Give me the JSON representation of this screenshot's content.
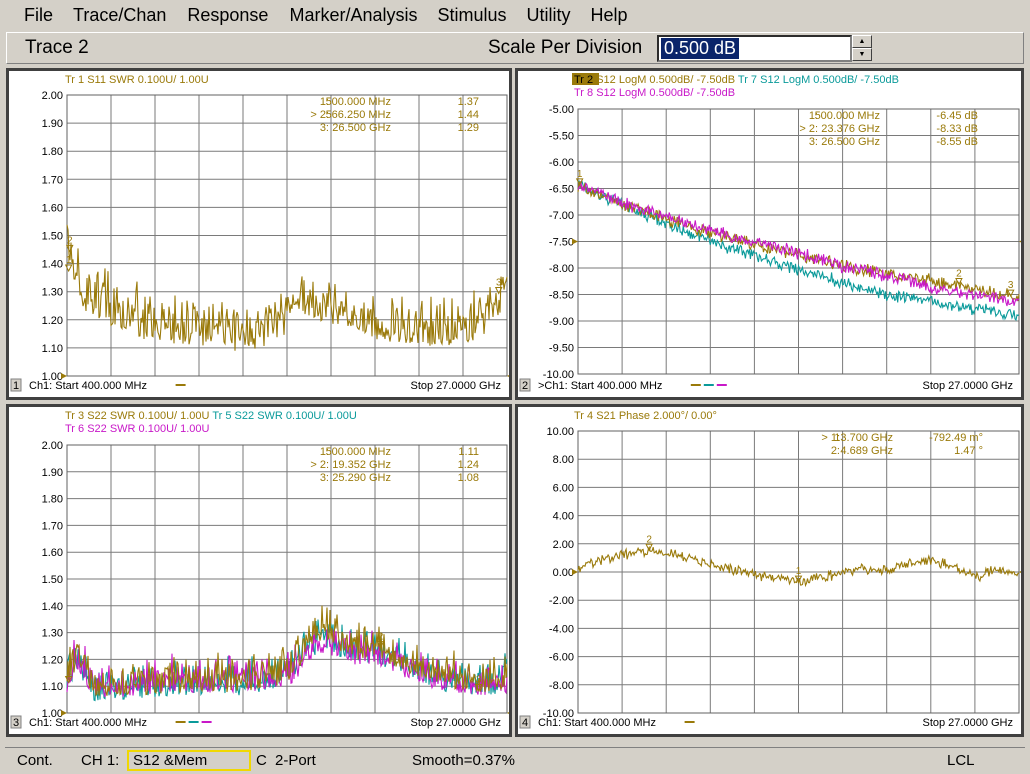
{
  "menu": [
    "File",
    "Trace/Chan",
    "Response",
    "Marker/Analysis",
    "Stimulus",
    "Utility",
    "Help"
  ],
  "toolbar": {
    "trace_name": "Trace 2",
    "spd_label": "Scale Per Division",
    "spd_value": "0.500 dB"
  },
  "colors": {
    "gold": "#9a7a0a",
    "cyan": "#0a9a9a",
    "magenta": "#c818c8",
    "blue": "#2020d0",
    "green": "#208820",
    "grid": "#7a7a7a"
  },
  "panes": [
    {
      "number": "1",
      "title_lines": [
        [
          {
            "text": "Tr  1  S11 SWR 0.100U/  1.00U",
            "color": "gold"
          }
        ]
      ],
      "y_labels": [
        "2.00",
        "1.90",
        "1.80",
        "1.70",
        "1.60",
        "1.50",
        "1.40",
        "1.30",
        "1.20",
        "1.10",
        "1.00"
      ],
      "markers": [
        {
          "id": "1:",
          "freq": "500.000 MHz",
          "val": "1.37"
        },
        {
          "id": "> 2:",
          "freq": "566.250 MHz",
          "val": "1.44"
        },
        {
          "id": "3:",
          "freq": "26.500 GHz",
          "val": "1.29"
        }
      ],
      "footer_start": "Ch1: Start  400.000 MHz",
      "footer_stop": "Stop  27.0000 GHz"
    },
    {
      "number": "2",
      "title_lines": [
        [
          {
            "text": "Tr  2",
            "color": "gold",
            "box": true
          },
          {
            "text": "  S12 LogM 0.500dB/  -7.50dB",
            "color": "gold"
          },
          {
            "text": "          Tr  7  S12 LogM 0.500dB/  -7.50dB",
            "color": "cyan"
          }
        ],
        [
          {
            "text": "Tr  8  S12 LogM 0.500dB/  -7.50dB",
            "color": "magenta"
          }
        ]
      ],
      "y_labels": [
        "-5.00",
        "-5.50",
        "-6.00",
        "-6.50",
        "-7.00",
        "-7.50",
        "-8.00",
        "-8.50",
        "-9.00",
        "-9.50",
        "-10.00"
      ],
      "markers": [
        {
          "id": "1:",
          "freq": "500.000 MHz",
          "val": "-6.45 dB"
        },
        {
          "id": "> 2:",
          "freq": "23.376 GHz",
          "val": "-8.33 dB"
        },
        {
          "id": "3:",
          "freq": "26.500 GHz",
          "val": "-8.55 dB"
        }
      ],
      "footer_start": ">Ch1: Start  400.000 MHz",
      "footer_stop": "Stop  27.0000 GHz"
    },
    {
      "number": "3",
      "title_lines": [
        [
          {
            "text": "Tr  3  S22 SWR 0.100U/  1.00U",
            "color": "gold"
          },
          {
            "text": "          Tr  5  S22 SWR 0.100U/  1.00U",
            "color": "cyan"
          }
        ],
        [
          {
            "text": "Tr  6  S22 SWR 0.100U/  1.00U",
            "color": "magenta"
          }
        ]
      ],
      "y_labels": [
        "2.00",
        "1.90",
        "1.80",
        "1.70",
        "1.60",
        "1.50",
        "1.40",
        "1.30",
        "1.20",
        "1.10",
        "1.00"
      ],
      "markers": [
        {
          "id": "1:",
          "freq": "500.000 MHz",
          "val": "1.11"
        },
        {
          "id": "> 2:",
          "freq": "19.352 GHz",
          "val": "1.24"
        },
        {
          "id": "3:",
          "freq": "25.290 GHz",
          "val": "1.08"
        }
      ],
      "footer_start": "Ch1: Start  400.000 MHz",
      "footer_stop": "Stop  27.0000 GHz"
    },
    {
      "number": "4",
      "title_lines": [
        [
          {
            "text": "Tr  4  S21 Phase 2.000°/  0.00°",
            "color": "gold"
          }
        ]
      ],
      "y_labels": [
        "10.00",
        "8.00",
        "6.00",
        "4.00",
        "2.00",
        "0.00",
        "-2.00",
        "-4.00",
        "-6.00",
        "-8.00",
        "-10.00"
      ],
      "markers": [
        {
          "id": "> 1:",
          "freq": "13.700 GHz",
          "val": "-792.49 m°"
        },
        {
          "id": "2:",
          "freq": "4.689 GHz",
          "val": "1.47 °"
        }
      ],
      "footer_start": "Ch1: Start  400.000 MHz",
      "footer_stop": "Stop  27.0000 GHz"
    }
  ],
  "chart_data": [
    {
      "type": "line",
      "title": "Tr 1 S11 SWR",
      "x_range_ghz": [
        0.4,
        27.0
      ],
      "ylim": [
        1.0,
        2.0
      ],
      "grid": true,
      "series": [
        {
          "name": "Tr 1",
          "color": "gold",
          "x": [
            0.4,
            1.5,
            2.5,
            3.5,
            4.5,
            5.5,
            6.5,
            7.5,
            8.5,
            9.5,
            10.5,
            11.5,
            12.5,
            13.5,
            14.0,
            15.0,
            16.0,
            17.0,
            18.0,
            19.0,
            20.0,
            21.0,
            22.0,
            23.0,
            24.0,
            25.0,
            26.0,
            27.0
          ],
          "y": [
            1.44,
            1.25,
            1.22,
            1.2,
            1.18,
            1.15,
            1.14,
            1.14,
            1.14,
            1.13,
            1.12,
            1.12,
            1.14,
            1.17,
            1.27,
            1.24,
            1.22,
            1.2,
            1.18,
            1.16,
            1.15,
            1.14,
            1.14,
            1.13,
            1.14,
            1.15,
            1.2,
            1.29
          ]
        }
      ],
      "markers": [
        {
          "label": "1",
          "x": 0.5,
          "y": 1.37
        },
        {
          "label": "2",
          "x": 0.566,
          "y": 1.44
        },
        {
          "label": "3",
          "x": 26.5,
          "y": 1.29
        }
      ]
    },
    {
      "type": "line",
      "title": "Tr 2 / Tr 7 / Tr 8 S12 LogM",
      "x_range_ghz": [
        0.4,
        27.0
      ],
      "ylim": [
        -10.0,
        -5.0
      ],
      "grid": true,
      "series": [
        {
          "name": "Tr 2",
          "color": "gold",
          "x": [
            0.4,
            1,
            3,
            5,
            7,
            9,
            11,
            13,
            15,
            17,
            19,
            21,
            23,
            25,
            27
          ],
          "y": [
            -6.45,
            -6.55,
            -6.8,
            -7.0,
            -7.2,
            -7.4,
            -7.55,
            -7.7,
            -7.85,
            -8.0,
            -8.1,
            -8.2,
            -8.33,
            -8.45,
            -8.55
          ]
        },
        {
          "name": "Tr 7",
          "color": "cyan",
          "x": [
            0.4,
            1,
            3,
            5,
            7,
            9,
            11,
            13,
            15,
            17,
            19,
            21,
            23,
            25,
            27
          ],
          "y": [
            -6.4,
            -6.5,
            -6.8,
            -7.05,
            -7.35,
            -7.55,
            -7.75,
            -7.95,
            -8.15,
            -8.35,
            -8.5,
            -8.6,
            -8.7,
            -8.8,
            -8.9
          ]
        },
        {
          "name": "Tr 8",
          "color": "magenta",
          "x": [
            0.4,
            1,
            3,
            5,
            7,
            9,
            11,
            13,
            15,
            17,
            19,
            21,
            23,
            25,
            27
          ],
          "y": [
            -6.4,
            -6.5,
            -6.75,
            -6.95,
            -7.15,
            -7.35,
            -7.5,
            -7.65,
            -7.85,
            -8.0,
            -8.15,
            -8.3,
            -8.45,
            -8.55,
            -8.65
          ]
        }
      ],
      "markers": [
        {
          "label": "1",
          "x": 0.5,
          "y": -6.45
        },
        {
          "label": "2",
          "x": 23.376,
          "y": -8.33
        },
        {
          "label": "3",
          "x": 26.5,
          "y": -8.55
        }
      ]
    },
    {
      "type": "line",
      "title": "Tr 3 / Tr 5 / Tr 6 S22 SWR",
      "x_range_ghz": [
        0.4,
        27.0
      ],
      "ylim": [
        1.0,
        2.0
      ],
      "grid": true,
      "series": [
        {
          "name": "Tr 3",
          "color": "gold",
          "x": [
            0.4,
            1,
            2,
            3,
            5,
            7,
            9,
            11,
            13,
            14,
            15,
            16,
            17,
            18,
            19,
            20,
            22,
            24,
            26,
            27
          ],
          "y": [
            1.1,
            1.2,
            1.08,
            1.08,
            1.09,
            1.1,
            1.1,
            1.1,
            1.12,
            1.15,
            1.25,
            1.3,
            1.25,
            1.22,
            1.24,
            1.2,
            1.15,
            1.1,
            1.1,
            1.12
          ]
        },
        {
          "name": "Tr 5",
          "color": "cyan",
          "x": [
            0.4,
            1,
            2,
            3,
            5,
            7,
            9,
            11,
            13,
            14,
            15,
            16,
            17,
            18,
            19,
            20,
            22,
            24,
            26,
            27
          ],
          "y": [
            1.09,
            1.18,
            1.07,
            1.07,
            1.08,
            1.09,
            1.09,
            1.09,
            1.11,
            1.14,
            1.22,
            1.27,
            1.23,
            1.2,
            1.22,
            1.18,
            1.13,
            1.09,
            1.09,
            1.11
          ]
        },
        {
          "name": "Tr 6",
          "color": "magenta",
          "x": [
            0.4,
            1,
            2,
            3,
            5,
            7,
            9,
            11,
            13,
            14,
            15,
            16,
            17,
            18,
            19,
            20,
            22,
            24,
            26,
            27
          ],
          "y": [
            1.1,
            1.19,
            1.08,
            1.08,
            1.09,
            1.1,
            1.1,
            1.1,
            1.11,
            1.13,
            1.2,
            1.25,
            1.22,
            1.2,
            1.21,
            1.17,
            1.12,
            1.09,
            1.09,
            1.1
          ]
        }
      ],
      "markers": [
        {
          "label": "1",
          "x": 0.5,
          "y": 1.11
        },
        {
          "label": "2",
          "x": 19.352,
          "y": 1.24
        },
        {
          "label": "3",
          "x": 25.29,
          "y": 1.08
        }
      ]
    },
    {
      "type": "line",
      "title": "Tr 4 S21 Phase",
      "x_range_ghz": [
        0.4,
        27.0
      ],
      "ylim": [
        -10.0,
        10.0
      ],
      "grid": true,
      "series": [
        {
          "name": "Tr 4",
          "color": "gold",
          "x": [
            0.4,
            1,
            2,
            3,
            4,
            5,
            6,
            7,
            8,
            9,
            10,
            11,
            12,
            13,
            13.7,
            14.5,
            15.5,
            16.5,
            17.5,
            18.5,
            19.5,
            20.5,
            21.5,
            22.5,
            23.5,
            24.5,
            25.5,
            26.5,
            27
          ],
          "y": [
            0.2,
            0.5,
            0.9,
            1.2,
            1.4,
            1.47,
            1.3,
            1.0,
            0.7,
            0.4,
            0.1,
            -0.2,
            -0.4,
            -0.6,
            -0.79,
            -0.5,
            -0.3,
            0.0,
            0.2,
            0.0,
            0.3,
            0.6,
            0.8,
            0.6,
            0.1,
            -0.4,
            0.2,
            0.0,
            -0.2
          ]
        }
      ],
      "markers": [
        {
          "label": "1",
          "x": 13.7,
          "y": -0.79
        },
        {
          "label": "2",
          "x": 4.689,
          "y": 1.47
        }
      ]
    }
  ],
  "status": {
    "mode": "Cont.",
    "channel": "CH 1:",
    "cal": "S12 &Mem",
    "cal_flag": "C",
    "port": "2-Port",
    "smooth": "Smooth=0.37%",
    "remote": "LCL"
  }
}
